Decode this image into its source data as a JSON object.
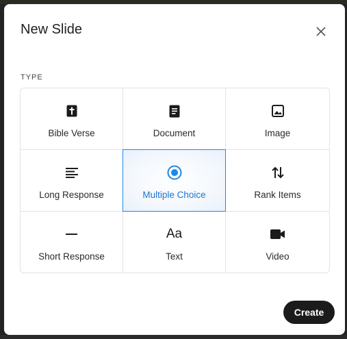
{
  "dialog": {
    "title": "New Slide",
    "section_label": "TYPE",
    "create_label": "Create"
  },
  "types": [
    {
      "label": "Bible Verse",
      "icon": "bible-icon"
    },
    {
      "label": "Document",
      "icon": "document-icon"
    },
    {
      "label": "Image",
      "icon": "image-icon"
    },
    {
      "label": "Long Response",
      "icon": "long-text-icon"
    },
    {
      "label": "Multiple Choice",
      "icon": "radio-icon",
      "selected": true
    },
    {
      "label": "Rank Items",
      "icon": "sort-arrows-icon"
    },
    {
      "label": "Short Response",
      "icon": "short-text-icon"
    },
    {
      "label": "Text",
      "icon": "text-aa-icon",
      "glyph": "Aa"
    },
    {
      "label": "Video",
      "icon": "video-camera-icon"
    }
  ],
  "colors": {
    "accent": "#1e88e5",
    "button_bg": "#1b1b1b"
  }
}
